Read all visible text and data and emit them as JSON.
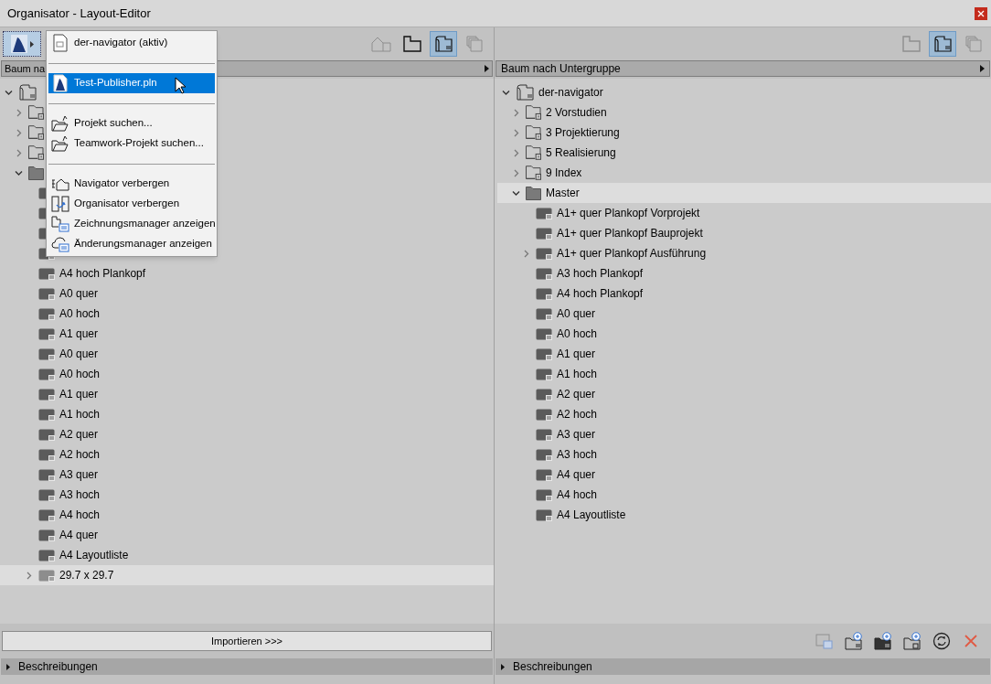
{
  "window": {
    "title": "Organisator - Layout-Editor"
  },
  "left_panel": {
    "source_button": {
      "selected": true
    },
    "view_buttons": [
      {
        "kind": "house",
        "disabled": true,
        "selected": false
      },
      {
        "kind": "folder",
        "disabled": false,
        "selected": false
      },
      {
        "kind": "layout",
        "disabled": false,
        "selected": true
      },
      {
        "kind": "stack",
        "disabled": true,
        "selected": false
      }
    ],
    "tree_mode": "Baum na",
    "tree": [
      {
        "kind": "project",
        "expanded": true,
        "selected": false,
        "children": [
          {
            "kind": "subset",
            "expanded": false,
            "selected": false
          },
          {
            "kind": "subset",
            "expanded": false,
            "selected": false
          },
          {
            "kind": "subset",
            "expanded": false,
            "selected": false
          },
          {
            "kind": "folder",
            "expanded": true,
            "selected": false,
            "children": [
              {
                "kind": "layout",
                "selected": false
              },
              {
                "kind": "layout",
                "selected": false
              },
              {
                "kind": "layout",
                "selected": false
              },
              {
                "kind": "layout",
                "selected": false
              },
              {
                "kind": "layout",
                "label": "A4 hoch Plankopf",
                "selected": false
              },
              {
                "kind": "layout",
                "label": "A0 quer",
                "selected": false
              },
              {
                "kind": "layout",
                "label": "A0 hoch",
                "selected": false
              },
              {
                "kind": "layout",
                "label": "A1 quer",
                "selected": false
              },
              {
                "kind": "layout",
                "label": "A0 quer",
                "selected": false
              },
              {
                "kind": "layout",
                "label": "A0 hoch",
                "selected": false
              },
              {
                "kind": "layout",
                "label": "A1 quer",
                "selected": false
              },
              {
                "kind": "layout",
                "label": "A1 hoch",
                "selected": false
              },
              {
                "kind": "layout",
                "label": "A2 quer",
                "selected": false
              },
              {
                "kind": "layout",
                "label": "A2 hoch",
                "selected": false
              },
              {
                "kind": "layout",
                "label": "A3 quer",
                "selected": false
              },
              {
                "kind": "layout",
                "label": "A3 hoch",
                "selected": false
              },
              {
                "kind": "layout",
                "label": "A4 hoch",
                "selected": false
              },
              {
                "kind": "layout",
                "label": "A4 quer",
                "selected": false
              },
              {
                "kind": "layout",
                "label": "A4 Layoutliste",
                "selected": false
              },
              {
                "kind": "layout",
                "label": "29.7 x 29.7",
                "expanded": false,
                "selected": true
              }
            ]
          }
        ]
      }
    ],
    "import_button": "Importieren >>>",
    "description_bar": "Beschreibungen"
  },
  "right_panel": {
    "view_buttons": [
      {
        "kind": "folder",
        "disabled": true,
        "selected": false
      },
      {
        "kind": "layout",
        "disabled": false,
        "selected": true
      },
      {
        "kind": "stack",
        "disabled": true,
        "selected": false
      }
    ],
    "tree_mode": "Baum nach Untergruppe",
    "tree": [
      {
        "kind": "project",
        "label": "der-navigator",
        "expanded": true,
        "selected": false,
        "children": [
          {
            "kind": "subset",
            "label": "2 Vorstudien",
            "expanded": false,
            "selected": false
          },
          {
            "kind": "subset",
            "label": "3 Projektierung",
            "expanded": false,
            "selected": false
          },
          {
            "kind": "subset",
            "label": "5 Realisierung",
            "expanded": false,
            "selected": false
          },
          {
            "kind": "subset",
            "label": "9 Index",
            "expanded": false,
            "selected": false
          },
          {
            "kind": "folder",
            "label": "Master",
            "expanded": true,
            "selected": true,
            "children": [
              {
                "kind": "layout",
                "label": "A1+ quer Plankopf Vorprojekt",
                "selected": false
              },
              {
                "kind": "layout",
                "label": "A1+ quer Plankopf Bauprojekt",
                "selected": false
              },
              {
                "kind": "layout",
                "label": "A1+ quer Plankopf Ausführung",
                "expanded": false,
                "selected": false
              },
              {
                "kind": "layout",
                "label": "A3 hoch Plankopf",
                "selected": false
              },
              {
                "kind": "layout",
                "label": "A4 hoch Plankopf",
                "selected": false
              },
              {
                "kind": "layout",
                "label": "A0 quer",
                "selected": false
              },
              {
                "kind": "layout",
                "label": "A0 hoch",
                "selected": false
              },
              {
                "kind": "layout",
                "label": "A1 quer",
                "selected": false
              },
              {
                "kind": "layout",
                "label": "A1 hoch",
                "selected": false
              },
              {
                "kind": "layout",
                "label": "A2 quer",
                "selected": false
              },
              {
                "kind": "layout",
                "label": "A2 hoch",
                "selected": false
              },
              {
                "kind": "layout",
                "label": "A3 quer",
                "selected": false
              },
              {
                "kind": "layout",
                "label": "A3 hoch",
                "selected": false
              },
              {
                "kind": "layout",
                "label": "A4 quer",
                "selected": false
              },
              {
                "kind": "layout",
                "label": "A4 hoch",
                "selected": false
              },
              {
                "kind": "layout",
                "label": "A4 Layoutliste",
                "selected": false
              }
            ]
          }
        ]
      }
    ],
    "actions": [
      {
        "kind": "layout-list",
        "disabled": true
      },
      {
        "kind": "new-folder",
        "disabled": false
      },
      {
        "kind": "new-layout",
        "disabled": false
      },
      {
        "kind": "new-subset",
        "disabled": false
      },
      {
        "kind": "refresh",
        "disabled": false
      },
      {
        "kind": "delete",
        "disabled": false
      }
    ],
    "description_bar": "Beschreibungen"
  },
  "project_menu": {
    "items": [
      {
        "kind": "item",
        "label": "der-navigator (aktiv)",
        "selected": false
      },
      {
        "kind": "separator"
      },
      {
        "kind": "item",
        "label": "Test-Publisher.pln",
        "selected": true
      },
      {
        "kind": "separator"
      },
      {
        "kind": "item",
        "label": "Projekt suchen...",
        "selected": false
      },
      {
        "kind": "item",
        "label": "Teamwork-Projekt suchen...",
        "selected": false
      },
      {
        "kind": "separator"
      },
      {
        "kind": "item",
        "label": "Navigator verbergen",
        "selected": false
      },
      {
        "kind": "item",
        "label": "Organisator verbergen",
        "selected": false
      },
      {
        "kind": "item",
        "label": "Zeichnungsmanager anzeigen",
        "selected": false
      },
      {
        "kind": "item",
        "label": "Änderungsmanager anzeigen",
        "selected": false
      }
    ]
  }
}
